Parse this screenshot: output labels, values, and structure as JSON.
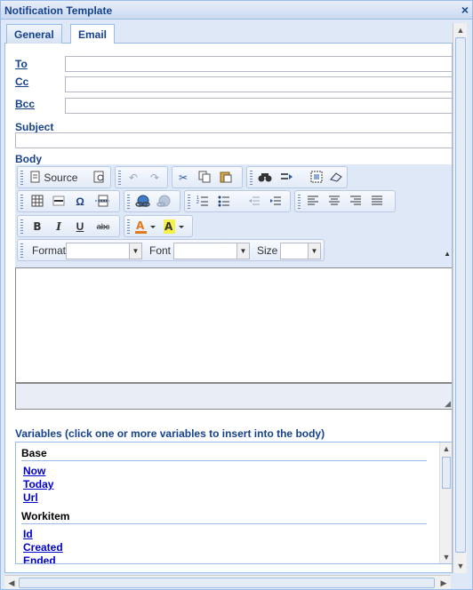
{
  "window": {
    "title": "Notification Template",
    "close_glyph": "×"
  },
  "tabs": [
    {
      "label": "General",
      "active": false
    },
    {
      "label": "Email",
      "active": true
    }
  ],
  "fields": {
    "to_label": "To",
    "cc_label": "Cc",
    "bcc_label": "Bcc",
    "subject_label": "Subject",
    "body_label": "Body"
  },
  "toolbar": {
    "source_label": "Source",
    "format_label": "Format",
    "font_label": "Font",
    "size_label": "Size",
    "icons": {
      "source": "document-icon",
      "preview": "preview-icon",
      "undo": "undo-icon",
      "redo": "redo-icon",
      "cut": "cut-icon",
      "copy": "copy-icon",
      "paste": "paste-icon",
      "find": "find-icon",
      "replace": "replace-icon",
      "select_all": "select-all-icon",
      "remove_format": "eraser-icon",
      "table": "table-icon",
      "horizontal_rule": "horizontal-rule-icon",
      "special_char": "omega-icon",
      "page_break": "page-break-icon",
      "link": "link-icon",
      "unlink": "unlink-icon",
      "numbered_list": "numbered-list-icon",
      "bulleted_list": "bulleted-list-icon",
      "outdent": "outdent-icon",
      "indent": "indent-icon",
      "align_left": "align-left-icon",
      "align_center": "align-center-icon",
      "align_right": "align-right-icon",
      "justify": "justify-icon",
      "bold": "bold-icon",
      "italic": "italic-icon",
      "underline": "underline-icon",
      "strike": "strike-icon",
      "text_color": "text-color-icon",
      "bg_color": "background-color-icon"
    },
    "glyphs": {
      "bold": "B",
      "italic": "I",
      "underline": "U",
      "strike": "abc",
      "omega": "Ω"
    }
  },
  "variables": {
    "header": "Variables (click one or more variables to insert into the body)",
    "groups": [
      {
        "name": "Base",
        "items": [
          "Now",
          "Today",
          "Url"
        ]
      },
      {
        "name": "Workitem",
        "items": [
          "Id",
          "Created",
          "Ended"
        ]
      }
    ]
  },
  "colors": {
    "accent": "#15428b",
    "border": "#99bbe8",
    "link": "#0000cc",
    "panel_bg": "#dfe8f6"
  }
}
